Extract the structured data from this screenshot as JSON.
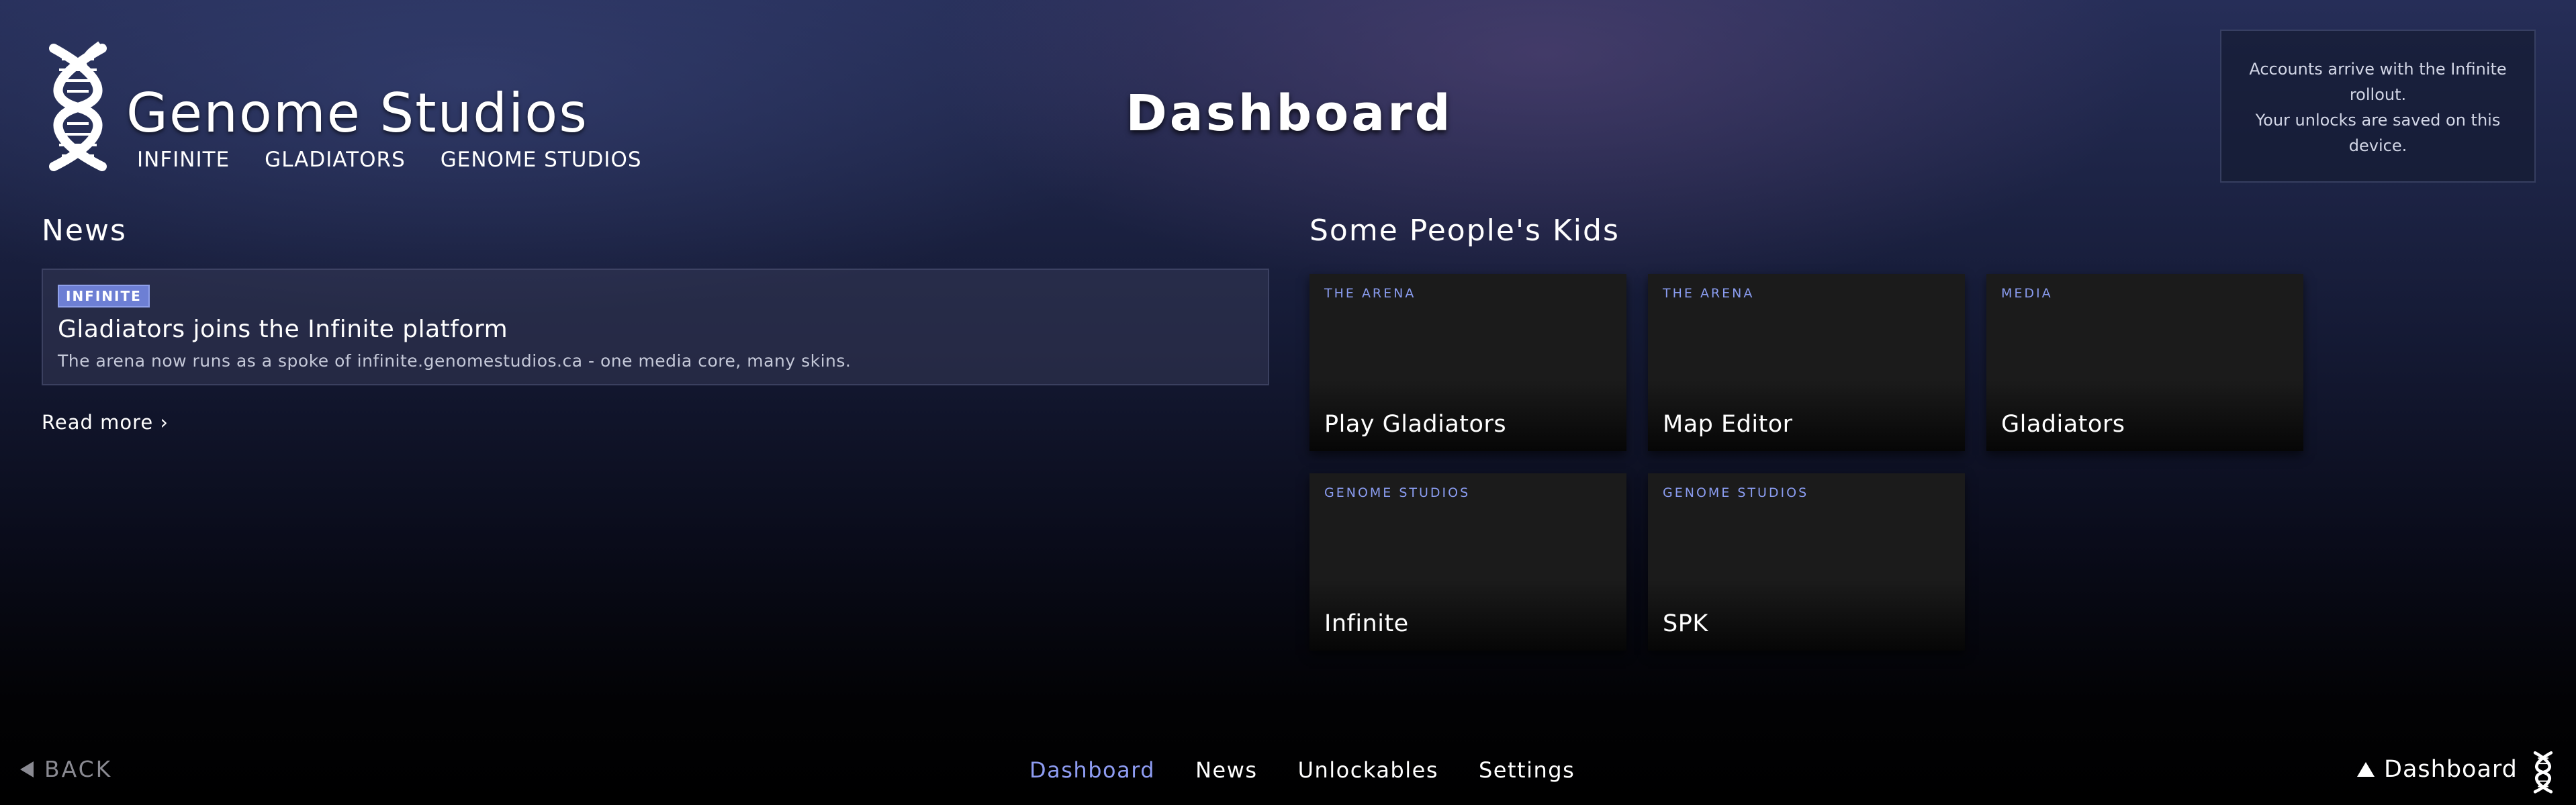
{
  "brand": {
    "title": "Genome Studios",
    "nav": [
      "INFINITE",
      "GLADIATORS",
      "GENOME STUDIOS"
    ],
    "logo_icon": "dna-helix-icon"
  },
  "page": {
    "title": "Dashboard"
  },
  "notice": {
    "line1": "Accounts arrive with the Infinite rollout.",
    "line2": "Your unlocks are saved on this device."
  },
  "news": {
    "heading": "News",
    "item": {
      "badge": "INFINITE",
      "title": "Gladiators joins the Infinite platform",
      "snippet": "The arena now runs as a spoke of infinite.genomestudios.ca - one media core, many skins."
    },
    "read_more": "Read more ›"
  },
  "spk": {
    "heading": "Some People's Kids",
    "tiles": [
      {
        "category": "THE ARENA",
        "label": "Play Gladiators"
      },
      {
        "category": "THE ARENA",
        "label": "Map Editor"
      },
      {
        "category": "MEDIA",
        "label": "Gladiators"
      },
      {
        "category": "GENOME STUDIOS",
        "label": "Infinite"
      },
      {
        "category": "GENOME STUDIOS",
        "label": "SPK"
      }
    ]
  },
  "footer": {
    "back_label": "BACK",
    "nav": [
      {
        "label": "Dashboard",
        "active": true
      },
      {
        "label": "News",
        "active": false
      },
      {
        "label": "Unlockables",
        "active": false
      },
      {
        "label": "Settings",
        "active": false
      }
    ],
    "current": "Dashboard"
  },
  "colors": {
    "accent": "#8e9cf2",
    "badge": "#6d7fd4",
    "tile_category": "#8a9cf0"
  }
}
